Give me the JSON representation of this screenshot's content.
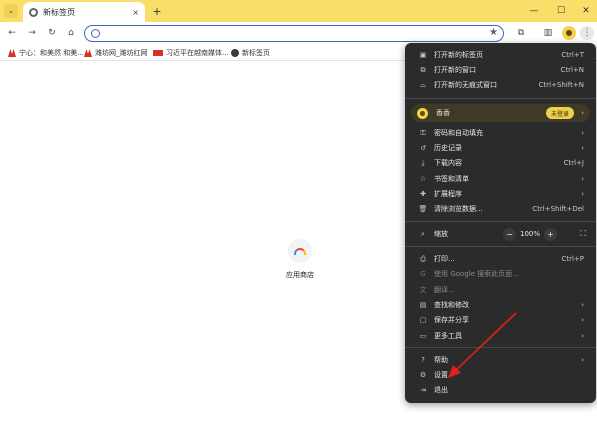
{
  "tabstrip": {
    "tab_title": "新标签页",
    "close_glyph": "×",
    "new_tab_glyph": "+",
    "menu_glyph": "⌄",
    "minimize_glyph": "—",
    "maximize_glyph": "☐",
    "close_window_glyph": "✕"
  },
  "toolbar": {
    "back_glyph": "←",
    "forward_glyph": "→",
    "reload_glyph": "↻",
    "home_glyph": "⌂",
    "star_glyph": "★",
    "extensions_glyph": "⧉",
    "sidepanel_glyph": "▥",
    "menu_glyph": "⋮",
    "omnibox_value": ""
  },
  "bookmarks": [
    {
      "label": "宁心：和美然 和美...",
      "icon": "red-logo-icon"
    },
    {
      "label": "潍坊网_潍坊红网",
      "icon": "red-logo-icon"
    },
    {
      "label": "习近平在越南媒体...",
      "icon": "news-badge-icon"
    },
    {
      "label": "新标签页",
      "icon": "globe-icon"
    }
  ],
  "content": {
    "shortcut_label": "应用商店"
  },
  "menu": {
    "new_tab": {
      "label": "打开新的标签页",
      "shortcut": "Ctrl+T",
      "icon": "new-tab-icon"
    },
    "new_window": {
      "label": "打开新的窗口",
      "shortcut": "Ctrl+N",
      "icon": "new-window-icon"
    },
    "incognito": {
      "label": "打开新的无痕式窗口",
      "shortcut": "Ctrl+Shift+N",
      "icon": "incognito-icon"
    },
    "profile": {
      "name": "香香",
      "badge": "未登录"
    },
    "passwords": {
      "label": "密码和自动填充",
      "icon": "key-icon"
    },
    "history": {
      "label": "历史记录",
      "icon": "history-icon"
    },
    "downloads": {
      "label": "下载内容",
      "shortcut": "Ctrl+J",
      "icon": "download-icon"
    },
    "bookmarks": {
      "label": "书签和清单",
      "icon": "star-icon"
    },
    "extensions": {
      "label": "扩展程序",
      "icon": "extension-icon"
    },
    "clear_data": {
      "label": "清除浏览数据...",
      "shortcut": "Ctrl+Shift+Del",
      "icon": "trash-icon"
    },
    "zoom": {
      "label": "缩放",
      "minus": "−",
      "value": "100%",
      "plus": "+",
      "icon": "zoom-icon"
    },
    "print": {
      "label": "打印...",
      "shortcut": "Ctrl+P",
      "icon": "print-icon"
    },
    "google_search": {
      "label": "使用 Google 搜索此页面...",
      "icon": "google-icon"
    },
    "translate": {
      "label": "翻译...",
      "icon": "translate-icon"
    },
    "find_edit": {
      "label": "查找和修改",
      "icon": "find-icon"
    },
    "save_share": {
      "label": "保存并分享",
      "icon": "save-icon"
    },
    "more_tools": {
      "label": "更多工具",
      "icon": "toolbox-icon"
    },
    "help": {
      "label": "帮助",
      "icon": "help-icon"
    },
    "settings": {
      "label": "设置",
      "icon": "gear-icon"
    },
    "exit": {
      "label": "退出",
      "icon": "exit-icon"
    },
    "arrow_glyph": "›"
  },
  "colors": {
    "tabstrip_bg": "#f9de6a",
    "menu_bg": "#2b2b2b",
    "profile_badge": "#f2d04f",
    "annotation_arrow": "#e02020"
  }
}
